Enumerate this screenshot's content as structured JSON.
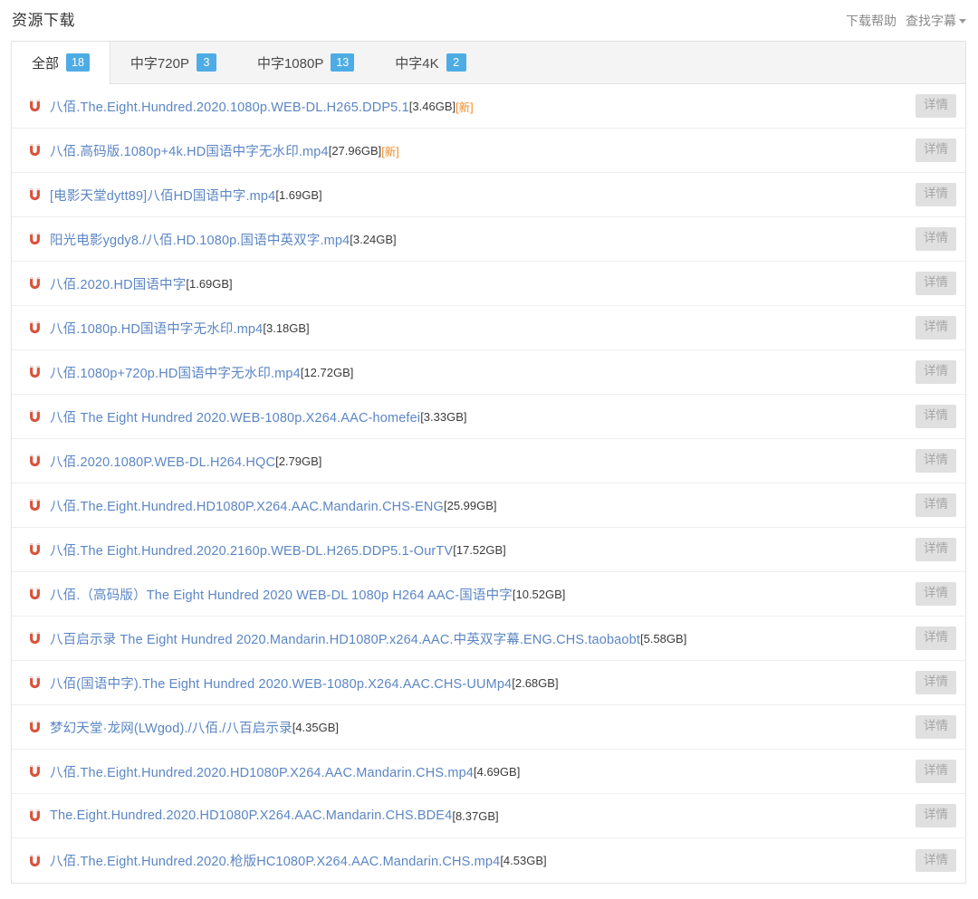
{
  "header": {
    "title": "资源下载",
    "links": [
      {
        "label": "下载帮助",
        "has_caret": false
      },
      {
        "label": "查找字幕",
        "has_caret": true
      }
    ]
  },
  "tabs": [
    {
      "label": "全部",
      "count": "18",
      "active": true
    },
    {
      "label": "中字720P",
      "count": "3",
      "active": false
    },
    {
      "label": "中字1080P",
      "count": "13",
      "active": false
    },
    {
      "label": "中字4K",
      "count": "2",
      "active": false
    }
  ],
  "detail_button_label": "详情",
  "icon_name": "magnet-icon",
  "colors": {
    "link": "#5b86c4",
    "badge": "#4eace5",
    "new_tag": "#f08a21",
    "magnet": "#d9533c",
    "detail_bg": "#e0e0e0",
    "detail_text": "#a6a6a6",
    "tabbar_bg": "#f4f4f4",
    "border": "#e2e2e2"
  },
  "rows": [
    {
      "name": "八佰.The.Eight.Hundred.2020.1080p.WEB-DL.H265.DDP5.1",
      "size": "[3.46GB]",
      "tag": "[新]"
    },
    {
      "name": "八佰.高码版.1080p+4k.HD国语中字无水印.mp4",
      "size": "[27.96GB]",
      "tag": "[新]"
    },
    {
      "name": "[电影天堂dytt89]八佰HD国语中字.mp4",
      "size": "[1.69GB]",
      "tag": ""
    },
    {
      "name": "阳光电影ygdy8./八佰.HD.1080p.国语中英双字.mp4",
      "size": "[3.24GB]",
      "tag": ""
    },
    {
      "name": "八佰.2020.HD国语中字",
      "size": "[1.69GB]",
      "tag": ""
    },
    {
      "name": "八佰.1080p.HD国语中字无水印.mp4",
      "size": "[3.18GB]",
      "tag": ""
    },
    {
      "name": "八佰.1080p+720p.HD国语中字无水印.mp4",
      "size": "[12.72GB]",
      "tag": ""
    },
    {
      "name": "八佰 The Eight Hundred 2020.WEB-1080p.X264.AAC-homefei",
      "size": "[3.33GB]",
      "tag": ""
    },
    {
      "name": "八佰.2020.1080P.WEB-DL.H264.HQC",
      "size": "[2.79GB]",
      "tag": ""
    },
    {
      "name": "八佰.The.Eight.Hundred.HD1080P.X264.AAC.Mandarin.CHS-ENG",
      "size": "[25.99GB]",
      "tag": ""
    },
    {
      "name": "八佰.The  Eight.Hundred.2020.2160p.WEB-DL.H265.DDP5.1-OurTV",
      "size": "[17.52GB]",
      "tag": ""
    },
    {
      "name": "八佰.（高码版）The Eight Hundred 2020 WEB-DL 1080p H264 AAC-国语中字",
      "size": "[10.52GB]",
      "tag": ""
    },
    {
      "name": "八百启示录 The Eight Hundred 2020.Mandarin.HD1080P.x264.AAC.中英双字幕.ENG.CHS.taobaobt",
      "size": "[5.58GB]",
      "tag": ""
    },
    {
      "name": "八佰(国语中字).The Eight Hundred 2020.WEB-1080p.X264.AAC.CHS-UUMp4",
      "size": "[2.68GB]",
      "tag": ""
    },
    {
      "name": "梦幻天堂·龙网(LWgod)./八佰./八百启示录",
      "size": "[4.35GB]",
      "tag": ""
    },
    {
      "name": "八佰.The.Eight.Hundred.2020.HD1080P.X264.AAC.Mandarin.CHS.mp4",
      "size": "[4.69GB]",
      "tag": ""
    },
    {
      "name": "The.Eight.Hundred.2020.HD1080P.X264.AAC.Mandarin.CHS.BDE4",
      "size": "[8.37GB]",
      "tag": ""
    },
    {
      "name": "八佰.The.Eight.Hundred.2020.枪版HC1080P.X264.AAC.Mandarin.CHS.mp4",
      "size": "[4.53GB]",
      "tag": ""
    }
  ]
}
